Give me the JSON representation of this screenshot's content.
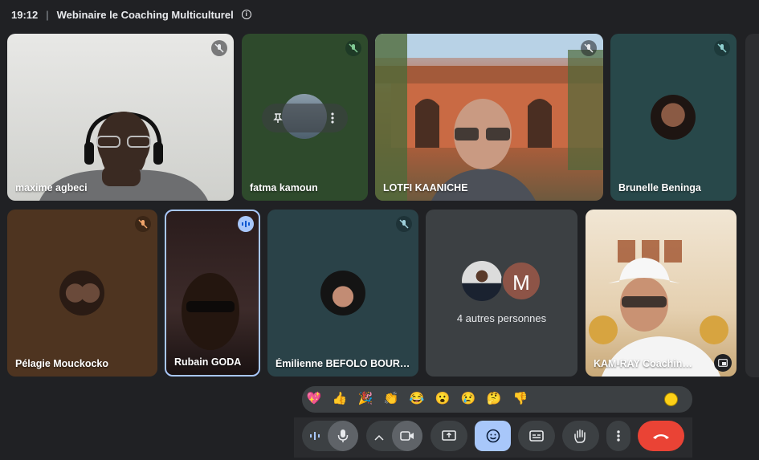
{
  "header": {
    "time": "19:12",
    "separator": "|",
    "title": "Webinaire le Coaching Multiculturel",
    "info_icon": "i"
  },
  "tiles": [
    {
      "name": "maxime agbeci",
      "muted": true
    },
    {
      "name": "fatma kamoun",
      "muted": true
    },
    {
      "name": "LOTFI KAANICHE",
      "muted": true
    },
    {
      "name": "Brunelle Beninga",
      "muted": true
    },
    {
      "name": "Pélagie Mouckocko",
      "muted": true
    },
    {
      "name": "Rubain GODA",
      "speaking": true
    },
    {
      "name": "Émilienne BEFOLO BOURGES",
      "muted": true
    },
    {
      "name": "4 autres personnes",
      "avatar_letter": "M"
    },
    {
      "name": "KAM-RAY Coaching Tunisie"
    }
  ],
  "reactions": [
    "💖",
    "👍",
    "🎉",
    "👏",
    "😂",
    "😮",
    "😢",
    "🤔",
    "👎"
  ],
  "controls": [
    "visual-effects",
    "microphone",
    "more-options-caret",
    "camera",
    "present-screen",
    "emoji-reactions",
    "captions",
    "raise-hand",
    "more-options",
    "leave-call"
  ],
  "colors": {
    "active_blue": "#a8c7fa",
    "leave_red": "#ea4335",
    "bar_bg": "#3c4043",
    "tile_highlight": "#a8c7fa"
  }
}
